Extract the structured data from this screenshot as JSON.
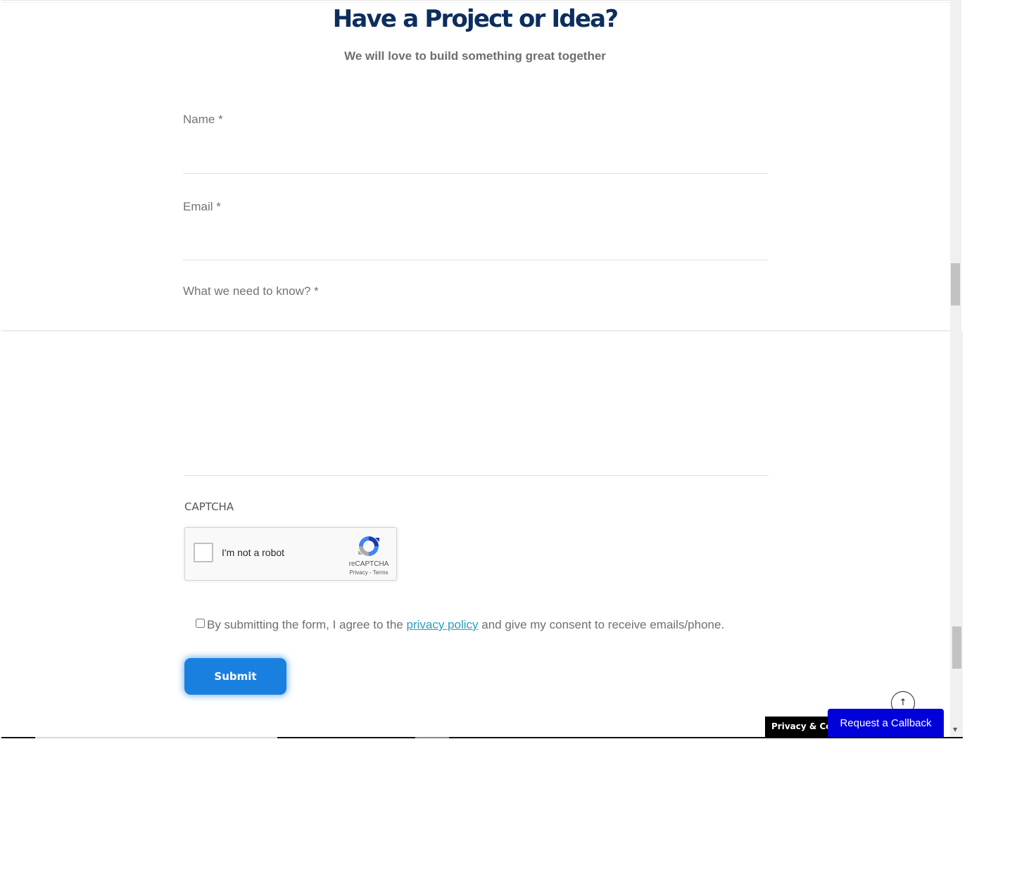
{
  "header": {
    "title": "Have a Project or Idea?",
    "subtitle": "We will love to build something great together"
  },
  "form": {
    "name": {
      "label": "Name *",
      "value": ""
    },
    "email": {
      "label": "Email *",
      "value": ""
    },
    "message": {
      "label": "What we need to know? *",
      "value": ""
    },
    "captcha": {
      "label": "CAPTCHA",
      "checkbox_text": "I'm not a robot",
      "brand": "reCAPTCHA",
      "links": "Privacy - Terms"
    },
    "consent": {
      "text_before": "By submitting the form, I agree to the ",
      "link_text": "privacy policy",
      "text_after": " and give my consent to receive emails/phone."
    },
    "submit_label": "Submit"
  },
  "widgets": {
    "back_to_top": "↑",
    "privacy_tab": "Privacy & Cookies Policy",
    "callback_label": "Request a Callback"
  },
  "colors": {
    "heading": "#0c2e5e",
    "submit": "#1a80e0",
    "link": "#2a9fbb",
    "callback": "#0000d9"
  }
}
